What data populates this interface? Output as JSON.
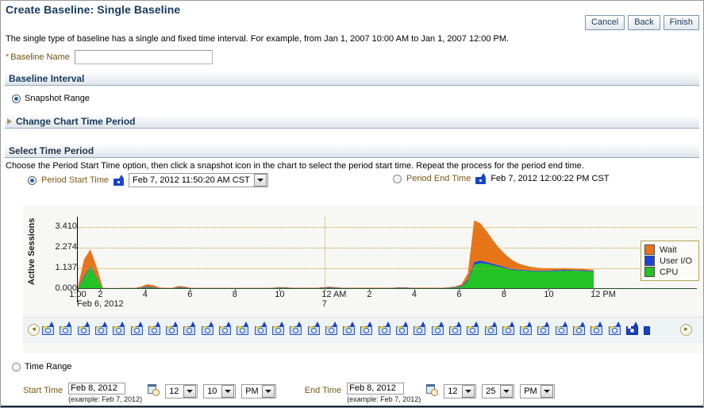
{
  "header": {
    "title": "Create Baseline: Single Baseline",
    "buttons": [
      {
        "name": "cancel",
        "label": "Cancel"
      },
      {
        "name": "back",
        "label": "Back"
      },
      {
        "name": "finish",
        "label": "Finish"
      }
    ]
  },
  "intro": "The single type of baseline has a single and fixed time interval. For example, from Jan 1, 2007 10:00 AM to Jan 1, 2007 12:00 PM.",
  "baseline_name": {
    "required_marker": "*",
    "label": "Baseline Name",
    "value": "",
    "placeholder": ""
  },
  "baseline_interval": {
    "title": "Baseline Interval",
    "snapshot_range_label": "Snapshot Range",
    "snapshot_range_selected": true,
    "change_chart_time_period_label": "Change Chart Time Period"
  },
  "select_time_period": {
    "title": "Select Time Period",
    "help": "Choose the Period Start Time option, then click a snapshot icon in the chart to select the period start time. Repeat the process for the period end time.",
    "start": {
      "label": "Period Start Time",
      "selected": true,
      "value": "Feb 7, 2012 11:50:20 AM CST",
      "icon": "snapshot-icon"
    },
    "end": {
      "label": "Period End Time",
      "selected": false,
      "value": "Feb 7, 2012 12:00:22 PM CST",
      "icon": "snapshot-icon"
    }
  },
  "chart_data": {
    "type": "area",
    "title": "",
    "xlabel": "",
    "ylabel": "Active Sessions",
    "ylim": [
      0,
      3.979
    ],
    "yticks": [
      "0.000",
      "1.137",
      "2.274",
      "3.410"
    ],
    "ytick_values": [
      0.0,
      1.137,
      2.274,
      3.41
    ],
    "grid": true,
    "legend_position": "right",
    "stacked": true,
    "xticks": [
      {
        "label": "1:00",
        "x": 0
      },
      {
        "label": "2",
        "x": 1
      },
      {
        "label": "4",
        "x": 3
      },
      {
        "label": "6",
        "x": 5
      },
      {
        "label": "8",
        "x": 7
      },
      {
        "label": "10",
        "x": 9
      },
      {
        "label": "12 AM",
        "x": 11
      },
      {
        "label": "2",
        "x": 13
      },
      {
        "label": "4",
        "x": 15
      },
      {
        "label": "6",
        "x": 17
      },
      {
        "label": "8",
        "x": 19
      },
      {
        "label": "10",
        "x": 21
      },
      {
        "label": "12 PM",
        "x": 23
      }
    ],
    "xaxis_date_labels": [
      {
        "label": "Feb 6, 2012",
        "x": 1
      },
      {
        "label": "7",
        "x": 11
      }
    ],
    "series": [
      {
        "name": "CPU",
        "color": "#22c322",
        "values": [
          0.02,
          0.6,
          1.21,
          0.62,
          0.02,
          0.02,
          0.02,
          0.03,
          0.03,
          0.03,
          0.05,
          0.08,
          0.06,
          0.03,
          0.03,
          0.03,
          0.06,
          0.05,
          0.03,
          0.03,
          0.03,
          0.03,
          0.03,
          0.03,
          0.03,
          0.03,
          0.03,
          0.03,
          0.03,
          0.03,
          0.03,
          0.04,
          0.06,
          0.05,
          0.04,
          0.04,
          0.04,
          0.04,
          0.04,
          0.05,
          0.06,
          0.05,
          0.04,
          0.04,
          0.04,
          0.04,
          0.04,
          0.04,
          0.04,
          0.04,
          0.04,
          0.05,
          0.05,
          0.04,
          0.04,
          0.04,
          0.04,
          0.04,
          0.04,
          0.05,
          0.07,
          0.12,
          0.42,
          1.32,
          1.42,
          1.38,
          1.3,
          1.22,
          1.13,
          1.05,
          1.02,
          1.0,
          0.98,
          0.97,
          0.97,
          0.98,
          0.98,
          1.0,
          1.01,
          1.0,
          0.99,
          0.98,
          0.97
        ]
      },
      {
        "name": "User I/O",
        "color": "#1b44d6",
        "values": [
          0.02,
          0.08,
          0.05,
          0.04,
          0.01,
          0.01,
          0.01,
          0.01,
          0.01,
          0.01,
          0.02,
          0.04,
          0.03,
          0.01,
          0.01,
          0.01,
          0.03,
          0.03,
          0.01,
          0.01,
          0.01,
          0.01,
          0.01,
          0.01,
          0.01,
          0.01,
          0.01,
          0.01,
          0.01,
          0.01,
          0.01,
          0.01,
          0.02,
          0.02,
          0.01,
          0.01,
          0.01,
          0.01,
          0.01,
          0.02,
          0.03,
          0.02,
          0.01,
          0.01,
          0.01,
          0.01,
          0.01,
          0.01,
          0.01,
          0.01,
          0.01,
          0.02,
          0.02,
          0.01,
          0.01,
          0.01,
          0.01,
          0.01,
          0.01,
          0.02,
          0.03,
          0.04,
          0.1,
          0.16,
          0.14,
          0.1,
          0.08,
          0.07,
          0.06,
          0.05,
          0.04,
          0.04,
          0.04,
          0.04,
          0.04,
          0.04,
          0.05,
          0.05,
          0.04,
          0.04,
          0.04,
          0.04,
          0.03
        ]
      },
      {
        "name": "Wait",
        "color": "#e8741a",
        "values": [
          0.05,
          0.95,
          0.92,
          0.55,
          0.03,
          0.02,
          0.02,
          0.02,
          0.02,
          0.02,
          0.05,
          0.14,
          0.12,
          0.04,
          0.02,
          0.02,
          0.07,
          0.05,
          0.02,
          0.02,
          0.02,
          0.02,
          0.02,
          0.02,
          0.02,
          0.02,
          0.02,
          0.02,
          0.02,
          0.02,
          0.02,
          0.02,
          0.03,
          0.03,
          0.02,
          0.02,
          0.02,
          0.02,
          0.02,
          0.03,
          0.04,
          0.03,
          0.02,
          0.02,
          0.02,
          0.02,
          0.02,
          0.02,
          0.02,
          0.02,
          0.02,
          0.02,
          0.02,
          0.02,
          0.02,
          0.02,
          0.02,
          0.02,
          0.02,
          0.02,
          0.04,
          0.1,
          0.35,
          2.3,
          2.05,
          1.7,
          1.3,
          0.95,
          0.7,
          0.5,
          0.35,
          0.26,
          0.2,
          0.16,
          0.14,
          0.12,
          0.11,
          0.1,
          0.09,
          0.08,
          0.08,
          0.07,
          0.06
        ]
      }
    ],
    "legend": [
      {
        "name": "Wait",
        "color": "#e8741a"
      },
      {
        "name": "User I/O",
        "color": "#1b44d6"
      },
      {
        "name": "CPU",
        "color": "#22c322"
      }
    ]
  },
  "snapshot_strip": {
    "prev_icon": "prev-arrow-icon",
    "next_icon": "next-arrow-icon",
    "count": 35,
    "selected_index": 33,
    "half_index": 34
  },
  "time_range": {
    "label": "Time Range",
    "selected": false,
    "start": {
      "label": "Start Time",
      "date": "Feb 8, 2012",
      "example": "(example: Feb 7, 2012)",
      "hour": "12",
      "minute": "10",
      "meridiem": "PM",
      "calendar_icon": "calendar-icon"
    },
    "end": {
      "label": "End Time",
      "date": "Feb 8, 2012",
      "example": "(example: Feb 7, 2012)",
      "hour": "12",
      "minute": "25",
      "meridiem": "PM",
      "calendar_icon": "calendar-icon"
    }
  }
}
